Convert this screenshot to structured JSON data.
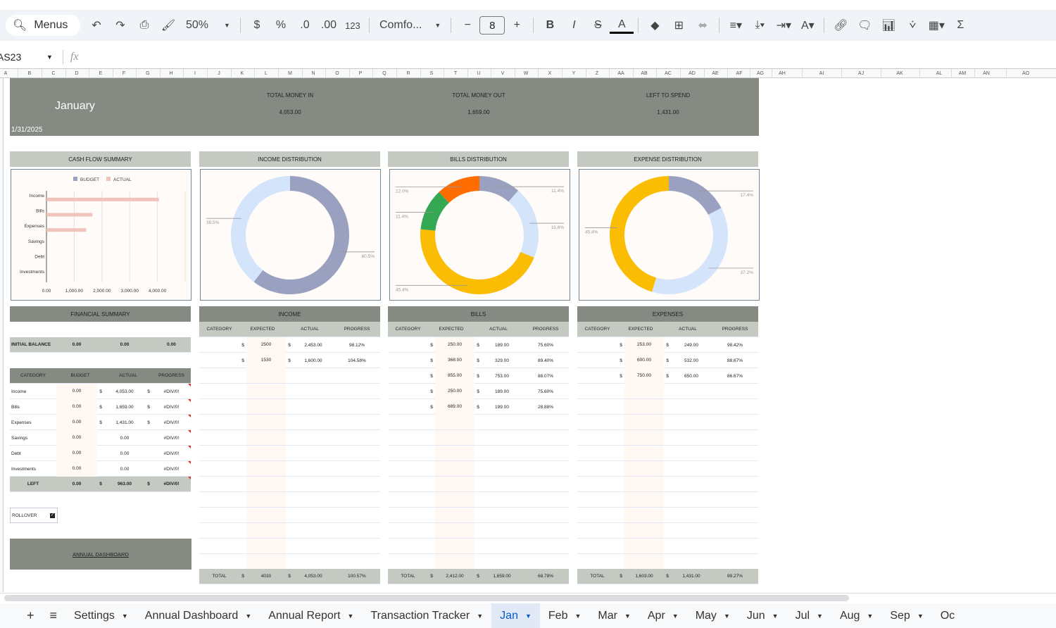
{
  "toolbar": {
    "menus_label": "Menus",
    "zoom": "50%",
    "currency": "$",
    "percent": "%",
    "dec_decrease": ".0",
    "dec_increase": ".00",
    "number_format": "123",
    "font": "Comfo...",
    "font_size": "8",
    "bold": "B",
    "italic": "I"
  },
  "formula_bar": {
    "cell_ref": "AS23",
    "fx": "fx",
    "value": ""
  },
  "columns": [
    "A",
    "B",
    "C",
    "D",
    "E",
    "F",
    "G",
    "H",
    "I",
    "J",
    "K",
    "L",
    "M",
    "N",
    "O",
    "P",
    "Q",
    "R",
    "S",
    "T",
    "U",
    "V",
    "W",
    "X",
    "Y",
    "Z",
    "AA",
    "AB",
    "AC",
    "AD",
    "AE",
    "AF",
    "AG",
    "AH",
    "AI",
    "AJ",
    "AK",
    "AL",
    "AM",
    "AN",
    "AO"
  ],
  "banner": {
    "month": "January",
    "date": "1/31/2025",
    "money_in_label": "TOTAL MONEY IN",
    "money_in": "4,053.00",
    "money_out_label": "TOTAL MONEY OUT",
    "money_out": "1,659.00",
    "left_label": "LEFT TO SPEND",
    "left": "1,431.00"
  },
  "sections": {
    "cash_flow": "CASH FLOW SUMMARY",
    "income_dist": "INCOME DISTRIBUTION",
    "bills_dist": "BILLS DISTRIBUTION",
    "expense_dist": "EXPENSE DISTRIBUTION"
  },
  "colors": {
    "header_dark": "#858a82",
    "header_light": "#c4c9c1",
    "gray_blue": "#9aa0c0",
    "light_blue": "#d4e4fb",
    "yellow": "#fbbc04",
    "green": "#34a853",
    "orange": "#ff6d01",
    "actual_bar": "#f0c4bb"
  },
  "chart_data": [
    {
      "type": "bar",
      "orientation": "horizontal",
      "categories": [
        "Income",
        "Bills",
        "Expenses",
        "Savings",
        "Debt",
        "Investments"
      ],
      "series": [
        {
          "name": "BUDGET",
          "values": [
            0,
            0,
            0,
            0,
            0,
            0
          ],
          "color": "#9aa0c0"
        },
        {
          "name": "ACTUAL",
          "values": [
            4053,
            1659,
            1431,
            0,
            0,
            0
          ],
          "color": "#f0c4bb"
        }
      ],
      "xlim": [
        0,
        5000
      ],
      "xticks": [
        "0.00",
        "1,000.00",
        "2,000.00",
        "3,000.00",
        "4,000.00"
      ],
      "legend": "top",
      "grid": true
    },
    {
      "type": "pie",
      "donut": true,
      "slices": [
        {
          "value": 60.5,
          "label": "60.5%",
          "color": "#9aa0c0"
        },
        {
          "value": 39.5,
          "label": "39.5%",
          "color": "#d4e4fb"
        }
      ]
    },
    {
      "type": "pie",
      "donut": true,
      "slices": [
        {
          "value": 11.4,
          "label": "11.4%",
          "color": "#9aa0c0"
        },
        {
          "value": 19.8,
          "label": "19.8%",
          "color": "#d4e4fb"
        },
        {
          "value": 45.4,
          "label": "45.4%",
          "color": "#fbbc04"
        },
        {
          "value": 11.4,
          "label": "11.4%",
          "color": "#34a853"
        },
        {
          "value": 12.0,
          "label": "12.0%",
          "color": "#ff6d01"
        }
      ]
    },
    {
      "type": "pie",
      "donut": true,
      "slices": [
        {
          "value": 17.4,
          "label": "17.4%",
          "color": "#9aa0c0"
        },
        {
          "value": 37.2,
          "label": "37.2%",
          "color": "#d4e4fb"
        },
        {
          "value": 45.4,
          "label": "45.4%",
          "color": "#fbbc04"
        }
      ]
    }
  ],
  "financial_summary": {
    "title": "FINANCIAL SUMMARY",
    "initial_balance": {
      "label": "INITIAL BALANCE",
      "values": [
        "0.00",
        "0.00",
        "0.00"
      ]
    },
    "headers": [
      "CATEGORY",
      "BUDGET",
      "ACTUAL",
      "PROGRESS"
    ],
    "rows": [
      [
        "Income",
        "0.00",
        "$",
        "4,053.00",
        "$",
        "#DIV/0!"
      ],
      [
        "Bills",
        "0.00",
        "$",
        "1,659.00",
        "$",
        "#DIV/0!"
      ],
      [
        "Expenses",
        "0.00",
        "$",
        "1,431.00",
        "$",
        "#DIV/0!"
      ],
      [
        "Savings",
        "0.00",
        "",
        "0.00",
        "",
        "#DIV/0!"
      ],
      [
        "Debt",
        "0.00",
        "",
        "0.00",
        "",
        "#DIV/0!"
      ],
      [
        "Investments",
        "0.00",
        "",
        "0.00",
        "",
        "#DIV/0!"
      ]
    ],
    "left": [
      "LEFT",
      "0.00",
      "$",
      "963.00",
      "$",
      "#DIV/0!"
    ],
    "rollover_label": "ROLLOVER",
    "rollover_checked": true,
    "annual_dashboard_link": "ANNUAL DASHBOARD"
  },
  "tables": [
    {
      "title": "INCOME",
      "headers": [
        "CATEGORY",
        "EXPECTED",
        "ACTUAL",
        "PROGRESS"
      ],
      "rows": [
        [
          "",
          "$",
          "2500",
          "$",
          "2,453.00",
          "98.12%"
        ],
        [
          "",
          "$",
          "1530",
          "$",
          "1,600.00",
          "104.58%"
        ]
      ],
      "total": [
        "TOTAL",
        "$",
        "4030",
        "$",
        "4,053.00",
        "100.57%"
      ]
    },
    {
      "title": "BILLS",
      "headers": [
        "CATEGORY",
        "EXPECTED",
        "ACTUAL",
        "PROGRESS"
      ],
      "rows": [
        [
          "",
          "$",
          "250.00",
          "$",
          "189.00",
          "75.60%"
        ],
        [
          "",
          "$",
          "368.00",
          "$",
          "329.00",
          "89.40%"
        ],
        [
          "",
          "$",
          "855.00",
          "$",
          "753.00",
          "88.07%"
        ],
        [
          "",
          "$",
          "250.00",
          "$",
          "189.00",
          "75.60%"
        ],
        [
          "",
          "$",
          "689.00",
          "$",
          "199.00",
          "28.88%"
        ]
      ],
      "total": [
        "TOTAL",
        "$",
        "2,412.00",
        "$",
        "1,659.00",
        "68.78%"
      ]
    },
    {
      "title": "EXPENSES",
      "headers": [
        "CATEGORY",
        "EXPECTED",
        "ACTUAL",
        "PROGRESS"
      ],
      "rows": [
        [
          "",
          "$",
          "253.00",
          "$",
          "249.00",
          "98.42%"
        ],
        [
          "",
          "$",
          "600.00",
          "$",
          "532.00",
          "88.67%"
        ],
        [
          "",
          "$",
          "750.00",
          "$",
          "650.00",
          "86.67%"
        ]
      ],
      "total": [
        "TOTAL",
        "$",
        "1,603.00",
        "$",
        "1,431.00",
        "89.27%"
      ]
    }
  ],
  "sheet_tabs": [
    {
      "label": "Settings"
    },
    {
      "label": "Annual Dashboard"
    },
    {
      "label": "Annual Report"
    },
    {
      "label": "Transaction Tracker"
    },
    {
      "label": "Jan",
      "active": true
    },
    {
      "label": "Feb"
    },
    {
      "label": "Mar"
    },
    {
      "label": "Apr"
    },
    {
      "label": "May"
    },
    {
      "label": "Jun"
    },
    {
      "label": "Jul"
    },
    {
      "label": "Aug"
    },
    {
      "label": "Sep"
    },
    {
      "label": "Oc"
    }
  ]
}
